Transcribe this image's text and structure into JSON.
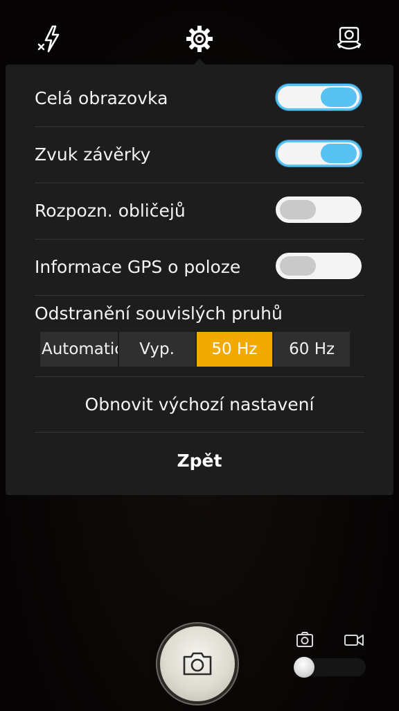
{
  "toolbar": {
    "flash_icon": "flash-off-icon",
    "settings_icon": "gear-icon",
    "switch_camera_icon": "switch-camera-icon"
  },
  "settings": {
    "rows": [
      {
        "label": "Celá obrazovka",
        "enabled": true
      },
      {
        "label": "Zvuk závěrky",
        "enabled": true
      },
      {
        "label": "Rozpozn. obličejů",
        "enabled": false
      },
      {
        "label": "Informace GPS o poloze",
        "enabled": false
      }
    ],
    "antibanding": {
      "title": "Odstranění souvislých pruhů",
      "options": [
        "Automatic",
        "Vyp.",
        "50 Hz",
        "60 Hz"
      ],
      "selected": "50 Hz"
    },
    "reset_label": "Obnovit výchozí nastavení",
    "back_label": "Zpět"
  },
  "bottom": {
    "shutter_icon": "camera-icon",
    "mode_photo_icon": "photo-mode-icon",
    "mode_video_icon": "video-mode-icon",
    "mode": "photo"
  },
  "colors": {
    "accent_toggle": "#58c2f3",
    "accent_selected": "#f2a900",
    "panel_bg": "#1d1d1d"
  }
}
